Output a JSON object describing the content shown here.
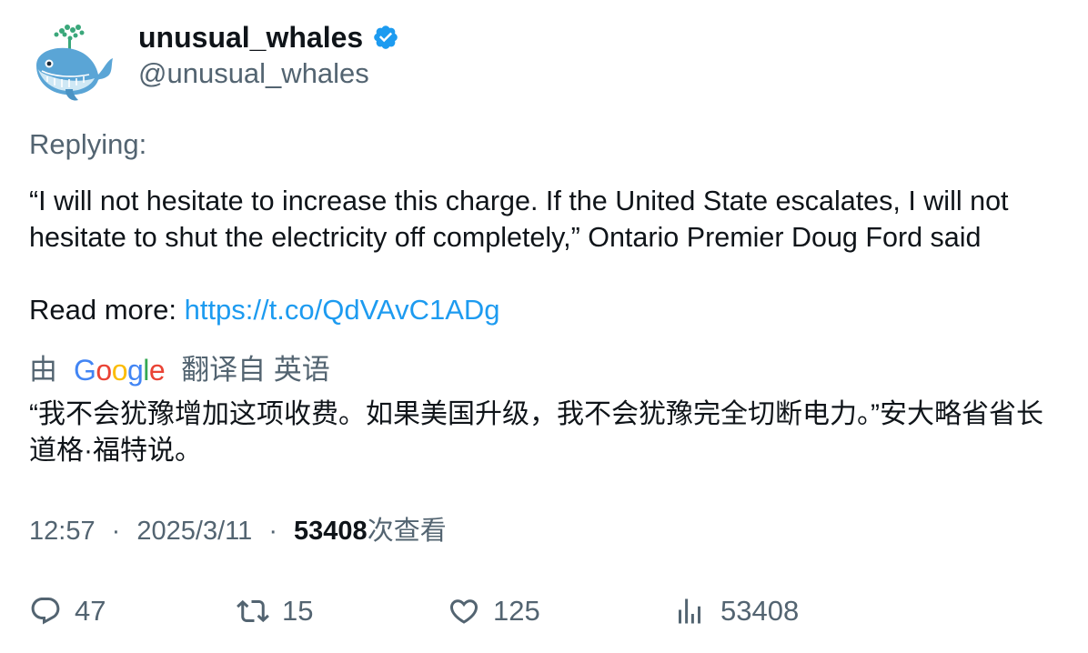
{
  "author": {
    "display_name": "unusual_whales",
    "handle": "@unusual_whales",
    "verified": true,
    "avatar_icon": "whale-icon",
    "badge_color": "#1d9bf0"
  },
  "replying_label": "Replying:",
  "tweet": {
    "text": "“I will not hesitate to increase this charge. If the United State escalates, I will not hesitate to shut the electricity off completely,” Ontario Premier Doug Ford said",
    "read_more_label": "Read more:",
    "link": "https://t.co/QdVAvC1ADg"
  },
  "translation": {
    "prefix": "由",
    "provider": "Google",
    "suffix": "翻译自 英语",
    "text": "“我不会犹豫增加这项收费。如果美国升级，我不会犹豫完全切断电力。”安大略省省长道格·福特说。"
  },
  "meta": {
    "time": "12:57",
    "separator": "·",
    "date": "2025/3/11",
    "views_count": "53408",
    "views_label": "次查看"
  },
  "actions": {
    "replies": "47",
    "retweets": "15",
    "likes": "125",
    "views": "53408"
  },
  "colors": {
    "link": "#1d9bf0",
    "secondary_text": "#536471",
    "primary_text": "#0f1419"
  }
}
